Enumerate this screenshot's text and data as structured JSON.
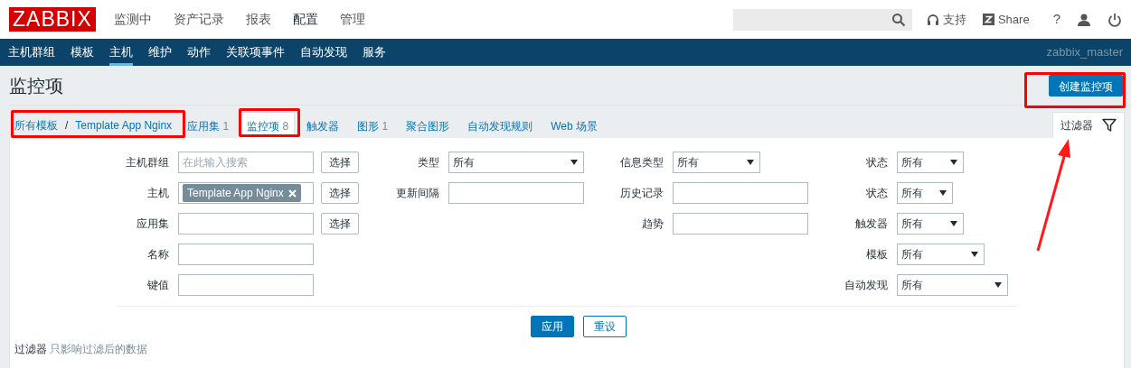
{
  "header": {
    "logo": "ZABBIX",
    "menu": [
      {
        "label": "监测中",
        "selected": false
      },
      {
        "label": "资产记录",
        "selected": false
      },
      {
        "label": "报表",
        "selected": false
      },
      {
        "label": "配置",
        "selected": true
      },
      {
        "label": "管理",
        "selected": false
      }
    ],
    "support": "支持",
    "share": "Share",
    "help": "?"
  },
  "subnav": {
    "items": [
      {
        "label": "主机群组",
        "selected": false
      },
      {
        "label": "模板",
        "selected": false
      },
      {
        "label": "主机",
        "selected": true
      },
      {
        "label": "维护",
        "selected": false
      },
      {
        "label": "动作",
        "selected": false
      },
      {
        "label": "关联项事件",
        "selected": false
      },
      {
        "label": "自动发现",
        "selected": false
      },
      {
        "label": "服务",
        "selected": false
      }
    ],
    "user": "zabbix_master"
  },
  "page": {
    "title": "监控项",
    "create_button": "创建监控项"
  },
  "breadcrumb": [
    "所有模板",
    "/",
    "Template App Nginx"
  ],
  "tabs": [
    {
      "label": "应用集",
      "count": "1",
      "selected": false
    },
    {
      "label": "监控项",
      "count": "8",
      "selected": true
    },
    {
      "label": "触发器",
      "selected": false
    },
    {
      "label": "图形",
      "count": "1",
      "selected": false
    },
    {
      "label": "聚合图形",
      "selected": false
    },
    {
      "label": "自动发现规则",
      "selected": false
    },
    {
      "label": "Web 场景",
      "selected": false
    }
  ],
  "filter_tab": {
    "label": "过滤器",
    "expanded": true
  },
  "filter": {
    "columns": [
      [
        {
          "label": "主机群组",
          "kind": "multiselect",
          "placeholder": "在此输入搜索",
          "button": "选择"
        },
        {
          "label": "主机",
          "kind": "multiselect",
          "tags": [
            "Template App Nginx"
          ],
          "button": "选择"
        },
        {
          "label": "应用集",
          "kind": "multiselect",
          "button": "选择"
        },
        {
          "label": "名称",
          "kind": "text"
        },
        {
          "label": "键值",
          "kind": "text"
        }
      ],
      [
        {
          "label": "类型",
          "kind": "select",
          "value": "所有"
        },
        {
          "label": "更新间隔",
          "kind": "text"
        }
      ],
      [
        {
          "label": "信息类型",
          "kind": "select",
          "value": "所有"
        },
        {
          "label": "历史记录",
          "kind": "text"
        },
        {
          "label": "趋势",
          "kind": "text"
        }
      ],
      [
        {
          "label": "状态",
          "kind": "select",
          "value": "所有"
        },
        {
          "label": "状态",
          "kind": "select",
          "value": "所有"
        },
        {
          "label": "触发器",
          "kind": "select",
          "value": "所有"
        },
        {
          "label": "模板",
          "kind": "select",
          "value": "所有"
        },
        {
          "label": "自动发现",
          "kind": "select",
          "value": "所有"
        }
      ]
    ],
    "apply": "应用",
    "reset": "重设",
    "note_title": "过滤器",
    "note": "只影响过滤后的数据"
  }
}
